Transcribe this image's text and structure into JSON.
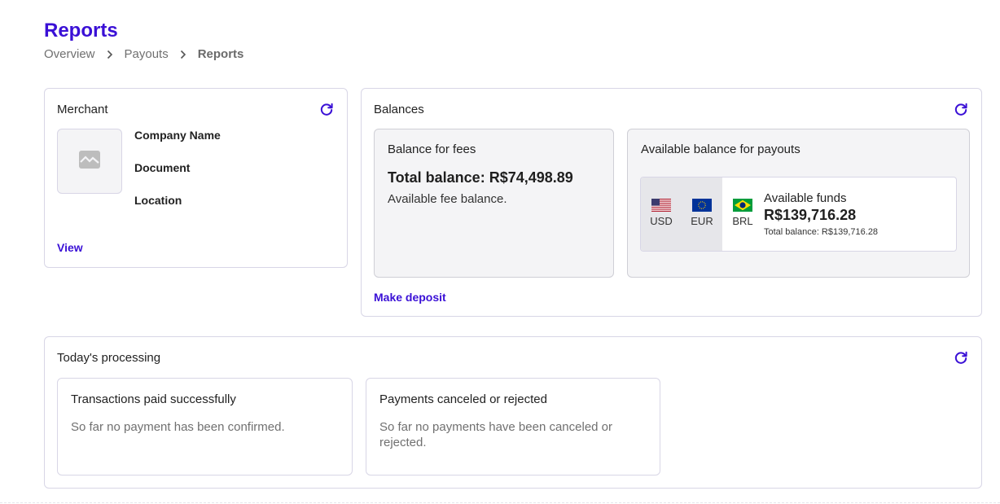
{
  "page": {
    "title": "Reports",
    "breadcrumb": [
      "Overview",
      "Payouts",
      "Reports"
    ]
  },
  "colors": {
    "accent": "#3a10d6",
    "border": "#d8d6e6",
    "subcard_bg": "#f4f4f6",
    "muted_text": "#707070"
  },
  "merchant": {
    "title": "Merchant",
    "refresh_icon": "refresh-icon",
    "logo_icon": "broken-image-icon",
    "fields": [
      "Company Name",
      "Document",
      "Location"
    ],
    "view_label": "View"
  },
  "balances": {
    "title": "Balances",
    "refresh_icon": "refresh-icon",
    "fees": {
      "title": "Balance for fees",
      "total": "Total balance: R$74,498.89",
      "note": "Available fee balance."
    },
    "payouts": {
      "title": "Available balance for payouts",
      "currencies": [
        {
          "code": "USD",
          "icon": "us-flag-icon"
        },
        {
          "code": "EUR",
          "icon": "eu-flag-icon"
        },
        {
          "code": "BRL",
          "icon": "brazil-flag-icon"
        }
      ],
      "selected_currency": "BRL",
      "funds_label": "Available funds",
      "funds_amount": "R$139,716.28",
      "funds_total": "Total balance: R$139,716.28"
    },
    "deposit_label": "Make deposit"
  },
  "processing": {
    "title": "Today's processing",
    "refresh_icon": "refresh-icon",
    "paid": {
      "title": "Transactions paid successfully",
      "message": "So far no payment has been confirmed."
    },
    "canceled": {
      "title": "Payments canceled or rejected",
      "message": "So far no payments have been canceled or rejected."
    }
  }
}
